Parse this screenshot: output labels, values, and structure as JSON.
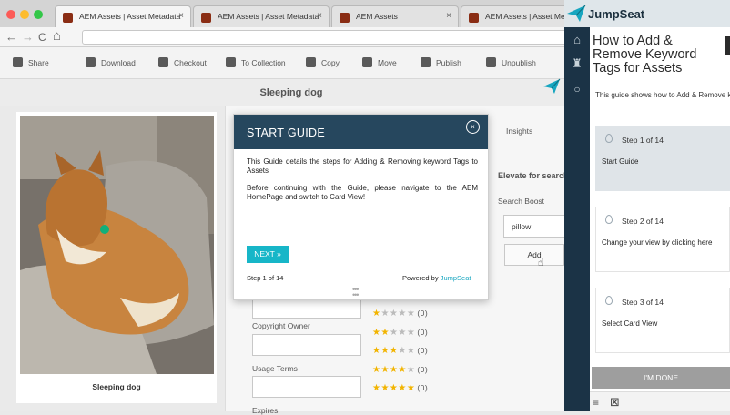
{
  "browser": {
    "tabs": [
      {
        "title": "AEM Assets | Asset Metadata",
        "close": "×"
      },
      {
        "title": "AEM Assets | Asset Metadata",
        "close": "×"
      },
      {
        "title": "AEM Assets",
        "close": "×"
      },
      {
        "title": "AEM Assets | Asset Metad",
        "close": ""
      }
    ],
    "nav": {
      "back": "←",
      "forward": "→",
      "reload": "C",
      "home": "⌂"
    }
  },
  "toolbar": {
    "items": [
      {
        "label": "Share",
        "icon": "share-icon"
      },
      {
        "label": "Download",
        "icon": "download-icon"
      },
      {
        "label": "Checkout",
        "icon": "lock-icon"
      },
      {
        "label": "To Collection",
        "icon": "collection-icon"
      },
      {
        "label": "Copy",
        "icon": "copy-icon"
      },
      {
        "label": "Move",
        "icon": "move-icon"
      },
      {
        "label": "Publish",
        "icon": "publish-icon"
      },
      {
        "label": "Unpublish",
        "icon": "unpublish-icon"
      }
    ]
  },
  "page": {
    "title": "Sleeping dog",
    "image_caption": "Sleeping dog"
  },
  "metadata": {
    "insights_tab": "Insights",
    "elevate_heading": "Elevate for search",
    "search_boost_label": "Search Boost",
    "search_boost_value": "pillow",
    "add_button": "Add",
    "copyright_label": "Copyright Owner",
    "usage_label": "Usage Terms",
    "expires_label": "Expires",
    "ratings": [
      {
        "filled": 1,
        "count": "(0)"
      },
      {
        "filled": 2,
        "count": "(0)"
      },
      {
        "filled": 3,
        "count": "(0)"
      },
      {
        "filled": 4,
        "count": "(0)"
      },
      {
        "filled": 5,
        "count": "(0)"
      }
    ]
  },
  "guide": {
    "title": "START GUIDE",
    "close": "×",
    "text1": "This Guide details the steps for Adding & Removing keyword Tags to Assets",
    "text2": "Before continuing with the Guide, please navigate to the AEM HomePage and switch to Card View!",
    "next": "NEXT »",
    "step": "Step 1 of 14",
    "powered_prefix": "Powered by ",
    "powered_brand": "JumpSeat"
  },
  "jumpseat": {
    "logo": "JumpSeat",
    "title": "How to Add & Remove Keyword Tags for Assets",
    "description": "This guide shows how to Add & Remove keyword Tags for assets",
    "steps": [
      {
        "num": "Step 1 of 14",
        "text": "Start Guide"
      },
      {
        "num": "Step 2 of 14",
        "text": "Change your view by clicking here"
      },
      {
        "num": "Step 3 of 14",
        "text": "Select Card View"
      }
    ],
    "done": "I'M DONE"
  },
  "colors": {
    "guide_header": "#26475e",
    "accent": "#17b6c8",
    "rail": "#1b3346",
    "star": "#f2b400"
  }
}
